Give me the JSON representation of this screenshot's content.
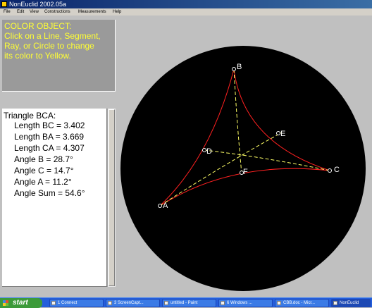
{
  "window": {
    "title": "NonEuclid 2002.05a"
  },
  "menu": [
    "File",
    "Edit",
    "View",
    "Constructions",
    "Measurements",
    "Help"
  ],
  "instruction": {
    "lines": [
      "COLOR OBJECT:",
      "Click on a Line, Segment,",
      "Ray, or Circle to change",
      "its color to Yellow."
    ],
    "color": "#ffff33"
  },
  "measurements": {
    "heading": "Triangle  BCA:",
    "lines": [
      "Length  BC = 3.402",
      "Length  BA = 3.669",
      "Length  CA = 4.307",
      "Angle   B = 28.7°",
      "Angle   C = 14.7°",
      "Angle   A = 11.2°",
      "Angle Sum  = 54.6°"
    ]
  },
  "canvas": {
    "points": [
      {
        "id": "A",
        "label": "A"
      },
      {
        "id": "B",
        "label": "B"
      },
      {
        "id": "C",
        "label": "C"
      },
      {
        "id": "D",
        "label": "D"
      },
      {
        "id": "E",
        "label": "E"
      },
      {
        "id": "F",
        "label": "F"
      }
    ],
    "triangle_color": "#ff2020",
    "median_color": "#ffff66",
    "disk_color": "#000000"
  },
  "taskbar": {
    "start_label": "start",
    "buttons": [
      "1 Connect",
      "3 ScreenCapt...",
      "untitled - Paint",
      "6 Windows ...",
      "CBB.doc - Micr...",
      "NonEuclid"
    ]
  }
}
